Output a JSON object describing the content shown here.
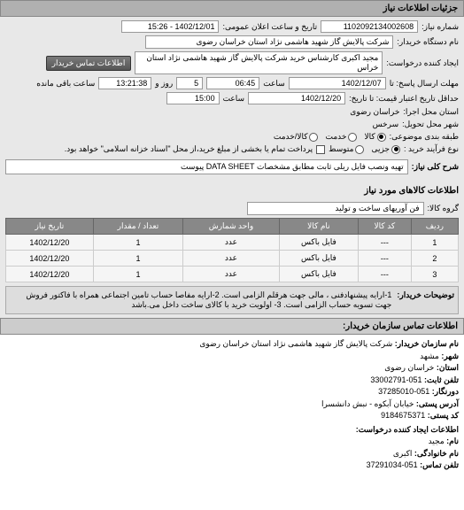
{
  "header": {
    "title": "جزئیات اطلاعات نیاز"
  },
  "fields": {
    "req_no_label": "شماره نیاز:",
    "req_no": "1102092134002608",
    "pub_time_label": "تاریخ و ساعت اعلان عمومی:",
    "pub_time": "1402/12/01 - 15:26",
    "buyer_org_label": "نام دستگاه خریدار:",
    "buyer_org": "شرکت پالایش گاز شهید هاشمی نژاد   استان خراسان رضوی",
    "creator_label": "ایجاد کننده درخواست:",
    "creator": "مجید اکبری کارشناس خرید شرکت پالایش گاز شهید هاشمی نژاد   استان خراس",
    "contact_btn": "اطلاعات تماس خریدار",
    "deadline_reply_label": "مهلت ارسال پاسخ: تا",
    "deadline_reply_date": "1402/12/07",
    "time_label": "ساعت",
    "deadline_reply_time": "06:45",
    "days_label": "روز و",
    "days_val": "5",
    "remain_label": "ساعت باقی مانده",
    "remain_val": "13:21:38",
    "valid_price_label": "حداقل تاریخ اعتبار قیمت: تا تاریخ:",
    "valid_price_date": "1402/12/20",
    "valid_price_time": "15:00",
    "exec_province_label": "استان محل اجرا:",
    "exec_province": "خراسان رضوی",
    "delivery_city_label": "شهر محل تحویل:",
    "delivery_city": "سرخس",
    "budget_class_label": "طبقه بندی موضوعی:",
    "budget_opts": {
      "goods": "کالا",
      "service": "خدمت",
      "both": "کالا/خدمت"
    },
    "process_type_label": "نوع فرآیند خرید :",
    "process_opts": {
      "minor": "جزیی",
      "medium": "متوسط"
    },
    "process_note": "پرداخت تمام یا بخشی از مبلغ خرید،از محل \"اسناد خزانه اسلامی\" خواهد بود.",
    "need_desc_label": "شرح کلی نیاز:",
    "need_desc": "تهیه ونصب فایل ریلی ثابت مطابق مشخصات DATA SHEET پیوست"
  },
  "items_section": {
    "title": "اطلاعات کالاهای مورد نیاز",
    "group_label": "گروه کالا:",
    "group_val": "فن آوریهای ساخت و تولید"
  },
  "table": {
    "headers": {
      "row": "ردیف",
      "code": "کد کالا",
      "name": "نام کالا",
      "unit": "واحد شمارش",
      "qty": "تعداد / مقدار",
      "date": "تاریخ نیاز"
    },
    "rows": [
      {
        "row": "1",
        "code": "---",
        "name": "فایل باکس",
        "unit": "عدد",
        "qty": "1",
        "date": "1402/12/20"
      },
      {
        "row": "2",
        "code": "---",
        "name": "فایل باکس",
        "unit": "عدد",
        "qty": "1",
        "date": "1402/12/20"
      },
      {
        "row": "3",
        "code": "---",
        "name": "فایل باکس",
        "unit": "عدد",
        "qty": "1",
        "date": "1402/12/20"
      }
    ]
  },
  "buyer_note": {
    "label": "توضیحات خریدار:",
    "text": "1-ارایه پیشنهادفنی ، مالی جهت هرقلم الزامی است. 2-ارایه مفاصا حساب تامین اجتماعی همراه با فاکتور فروش جهت تسویه حساب الزامی است. 3- اولویت خرید با کالای ساخت داخل می.باشد"
  },
  "contact": {
    "title": "اطلاعات تماس سازمان خریدار:",
    "org_label": "نام سازمان خریدار:",
    "org": "شرکت پالایش گاز شهید هاشمی نژاد استان خراسان رضوی",
    "city_label": "شهر:",
    "city": "مشهد",
    "province_label": "استان:",
    "province": "خراسان رضوی",
    "phone_label": "تلفن ثابت:",
    "phone": "051-33002791",
    "fax_label": "دورنگار:",
    "fax": "051-37285010",
    "addr_label": "آدرس پستی:",
    "addr": "خیابان آبکوه - نبش دانشسرا",
    "zip_label": "کد پستی:",
    "zip": "9184675371",
    "creator_title": "اطلاعات ایجاد کننده درخواست:",
    "name_label": "نام:",
    "name": "مجید",
    "family_label": "نام خانوادگی:",
    "family": "اکبری",
    "tel_label": "تلفن تماس:",
    "tel": "051-37291034"
  }
}
